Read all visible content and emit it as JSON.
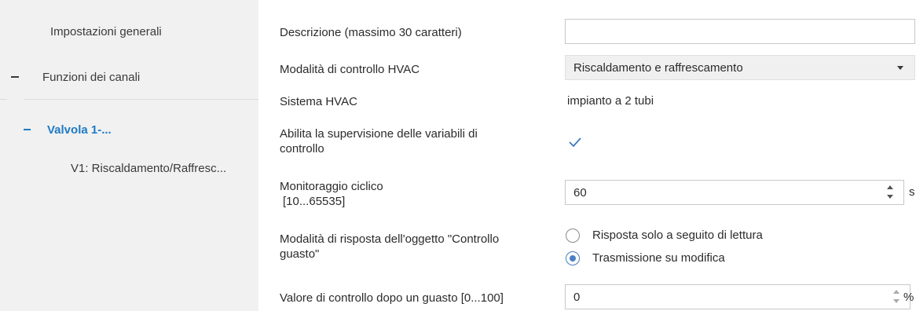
{
  "sidebar": {
    "general_settings": "Impostazioni generali",
    "channel_functions": "Funzioni dei canali",
    "valve": "Valvola 1-...",
    "valve_sub": "V1: Riscaldamento/Raffresc..."
  },
  "form": {
    "description_label": "Descrizione (massimo 30 caratteri)",
    "description_value": "",
    "hvac_mode_label": "Modalità di controllo HVAC",
    "hvac_mode_value": "Riscaldamento e raffrescamento",
    "hvac_system_label": "Sistema HVAC",
    "hvac_system_value": "impianto a 2 tubi",
    "supervision_label_line1": "Abilita la supervisione delle variabili di",
    "supervision_label_line2": "controllo",
    "supervision_checked": true,
    "cyclic_label": "Monitoraggio ciclico",
    "cyclic_range": "[10...65535]",
    "cyclic_value": "60",
    "cyclic_unit": "s",
    "response_label_line1": "Modalità di risposta dell'oggetto \"Controllo",
    "response_label_line2": "guasto\"",
    "response_options": [
      {
        "label": "Risposta solo a seguito di lettura",
        "selected": false
      },
      {
        "label": "Trasmissione su modifica",
        "selected": true
      }
    ],
    "fault_label": "Valore di controllo dopo un guasto [0...100]",
    "fault_value": "0",
    "fault_unit": "%"
  },
  "colors": {
    "accent": "#1f7ac4",
    "sidebar_bg": "#f1f1f1"
  }
}
